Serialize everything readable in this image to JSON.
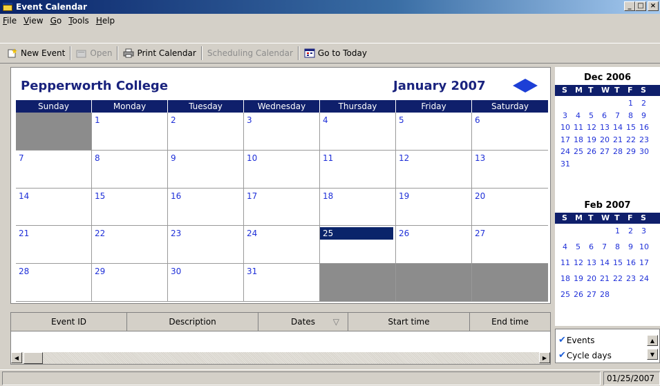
{
  "window": {
    "title": "Event Calendar",
    "min": "_",
    "max": "□",
    "close": "×"
  },
  "menu": [
    "File",
    "View",
    "Go",
    "Tools",
    "Help"
  ],
  "toolbar": {
    "new_event": "New Event",
    "open": "Open",
    "print_calendar": "Print Calendar",
    "scheduling_calendar": "Scheduling Calendar",
    "go_to_today": "Go to Today"
  },
  "calendar": {
    "org": "Pepperworth College",
    "month": "January 2007",
    "weekdays": [
      "Sunday",
      "Monday",
      "Tuesday",
      "Wednesday",
      "Thursday",
      "Friday",
      "Saturday"
    ],
    "first_weekday": 1,
    "days_in_month": 31,
    "selected_day": 25
  },
  "event_list": {
    "columns": [
      "Event ID",
      "Description",
      "Dates",
      "Start time",
      "End time"
    ],
    "sort_indicator": "▽"
  },
  "mini_calendars": [
    {
      "title": "Dec 2006",
      "first_weekday": 5,
      "days": 31
    },
    {
      "title": "Feb 2007",
      "first_weekday": 4,
      "days": 28
    }
  ],
  "mini_weekdays": [
    "S",
    "M",
    "T",
    "W",
    "T",
    "F",
    "S"
  ],
  "legend": {
    "events": "Events",
    "cycle_days": "Cycle days"
  },
  "status": {
    "date": "01/25/2007"
  },
  "colors": {
    "header_navy": "#0f1f6b",
    "day_blue": "#1e2fd8",
    "arrow": "#1d3fd6"
  }
}
